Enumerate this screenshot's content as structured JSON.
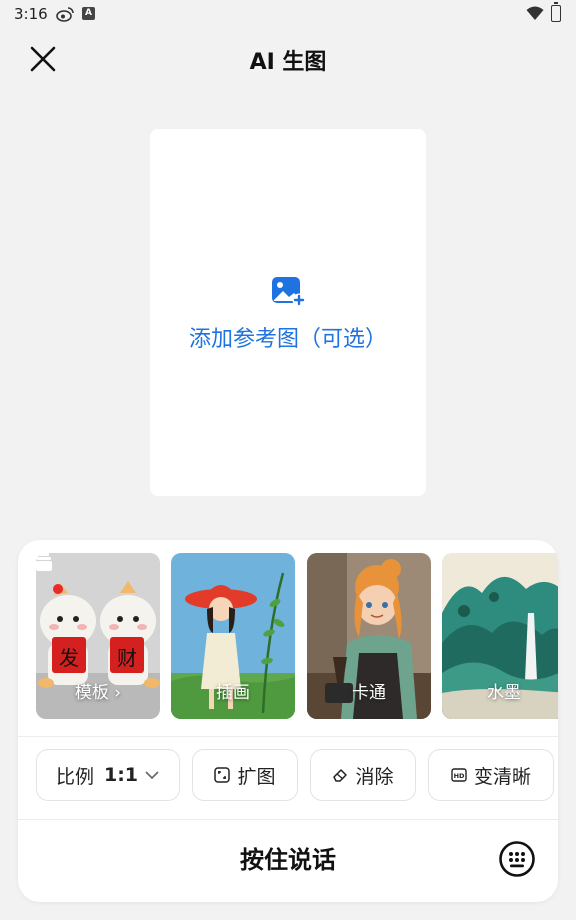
{
  "status_bar": {
    "time": "3:16"
  },
  "header": {
    "title": "AI 生图"
  },
  "reference": {
    "label": "添加参考图（可选）"
  },
  "styles": [
    {
      "label": "模板 ›",
      "name": "template"
    },
    {
      "label": "插画",
      "name": "illustration"
    },
    {
      "label": "卡通",
      "name": "cartoon"
    },
    {
      "label": "水墨",
      "name": "ink"
    }
  ],
  "template_card": {
    "text_left": "发",
    "text_right": "财"
  },
  "toolbar": {
    "ratio_label": "比例",
    "ratio_value": "1:1",
    "expand_label": "扩图",
    "erase_label": "消除",
    "hd_label": "变清晰"
  },
  "voice": {
    "label": "按住说话"
  },
  "colors": {
    "accent": "#1f73e0",
    "background": "#f2f2f2"
  }
}
